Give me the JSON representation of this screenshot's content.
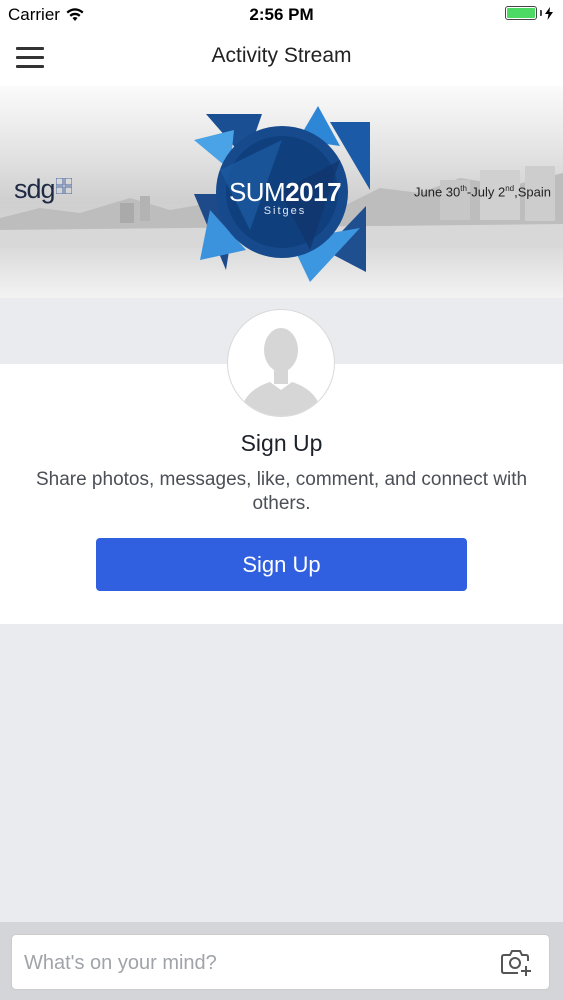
{
  "status_bar": {
    "carrier": "Carrier",
    "time": "2:56 PM",
    "icons": [
      "wifi-icon",
      "battery-icon",
      "charging-bolt-icon"
    ],
    "battery_color": "#4cd964"
  },
  "navbar": {
    "title": "Activity Stream",
    "menu_icon": "hamburger-menu-icon"
  },
  "banner": {
    "event_logo": "SUM2017",
    "logo_main_a": "SUM",
    "logo_main_b": "2017",
    "logo_sub": "Sitges",
    "sponsor": "sdg",
    "dates_a": "June 30",
    "dates_sup_a": "th",
    "dates_b": "-July 2",
    "dates_sup_b": "nd",
    "dates_c": ",Spain"
  },
  "signup_card": {
    "avatar_icon": "default-avatar-icon",
    "title": "Sign Up",
    "description": "Share photos, messages, like, comment, and connect with others.",
    "button_label": "Sign Up",
    "button_color": "#3060e0"
  },
  "composer": {
    "placeholder": "What's on your mind?",
    "value": "",
    "camera_icon": "add-photo-camera-icon"
  }
}
